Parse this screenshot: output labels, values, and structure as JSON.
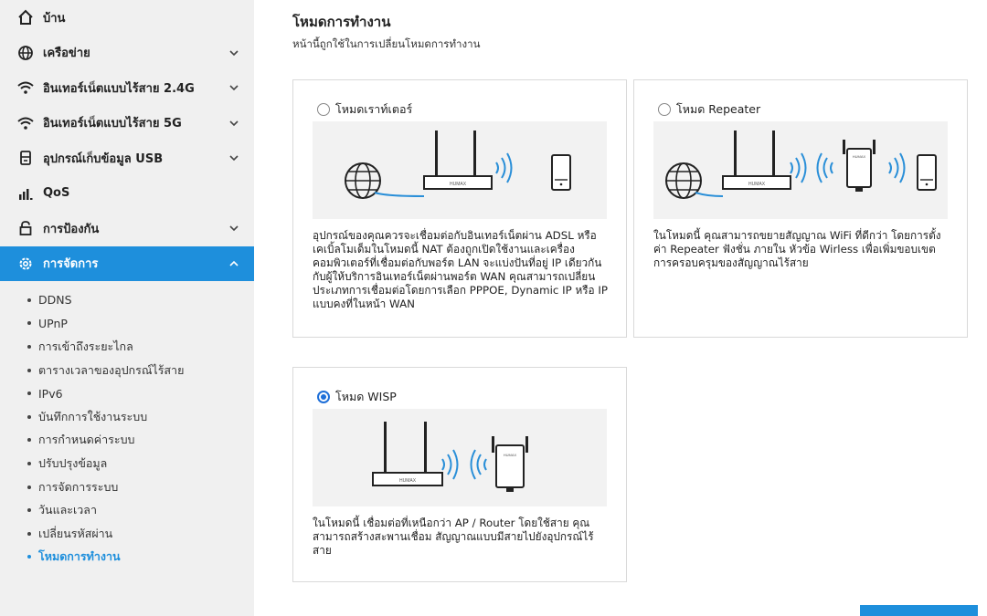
{
  "sidebar": {
    "items": [
      {
        "label": "บ้าน",
        "icon": "home-icon"
      },
      {
        "label": "เครือข่าย",
        "icon": "globe-icon"
      },
      {
        "label": "อินเทอร์เน็ตแบบไร้สาย 2.4G",
        "icon": "wifi-icon"
      },
      {
        "label": "อินเทอร์เน็ตแบบไร้สาย 5G",
        "icon": "wifi-icon"
      },
      {
        "label": "อุปกรณ์เก็บข้อมูล USB",
        "icon": "usb-storage-icon"
      },
      {
        "label": "QoS",
        "icon": "qos-bars-icon"
      },
      {
        "label": "การป้องกัน",
        "icon": "lock-icon"
      },
      {
        "label": "การจัดการ",
        "icon": "gear-icon"
      }
    ],
    "submenu": [
      "DDNS",
      "UPnP",
      "การเข้าถึงระยะไกล",
      "ตารางเวลาของอุปกรณ์ไร้สาย",
      "IPv6",
      "บันทึกการใช้งานระบบ",
      "การกำหนดค่าระบบ",
      "ปรับปรุงข้อมูล",
      "การจัดการระบบ",
      "วันและเวลา",
      "เปลี่ยนรหัสผ่าน",
      "โหมดการทำงาน"
    ],
    "accent_color": "#1e8fdc"
  },
  "main": {
    "title": "โหมดการทำงาน",
    "description": "หน้านี้ถูกใช้ในการเปลี่ยนโหมดการทำงาน",
    "modes": [
      {
        "label": "โหมดเราท์เตอร์",
        "checked": false,
        "description": "อุปกรณ์ของคุณควรจะเชื่อมต่อกับอินเทอร์เน็ตผ่าน ADSL หรือเคเบิ้ลโมเด็มในโหมดนี้ NAT ต้องถูกเปิดใช้งานและเครื่องคอมพิวเตอร์ที่เชื่อมต่อกับพอร์ต LAN จะแบ่งปันที่อยู่ IP เดียวกันกับผู้ให้บริการอินเทอร์เน็ตผ่านพอร์ต WAN คุณสามารถเปลี่ยนประเภทการเชื่อมต่อโดยการเลือก PPPOE, Dynamic IP หรือ IP แบบคงที่ในหน้า WAN"
      },
      {
        "label": "โหมด Repeater",
        "checked": false,
        "description": "ในโหมดนี้ คุณสามารถขยายสัญญาณ WiFi ที่ดีกว่า โดยการตั้งค่า Repeater ฟังชั่น ภายใน หัวข้อ Wirless เพื่อเพิ่มขอบเขตการครอบครุมของสัญญาณไร้สาย"
      },
      {
        "label": "โหมด WISP",
        "checked": true,
        "description": "ในโหมดนี้ เชื่อมต่อที่เหนือกว่า AP / Router โดยใช้สาย คุณสามารถสร้างสะพานเชื่อม สัญญาณแบบมีสายไปยังอุปกรณ์ไร้สาย"
      }
    ],
    "router_brand": "HUMAX"
  }
}
